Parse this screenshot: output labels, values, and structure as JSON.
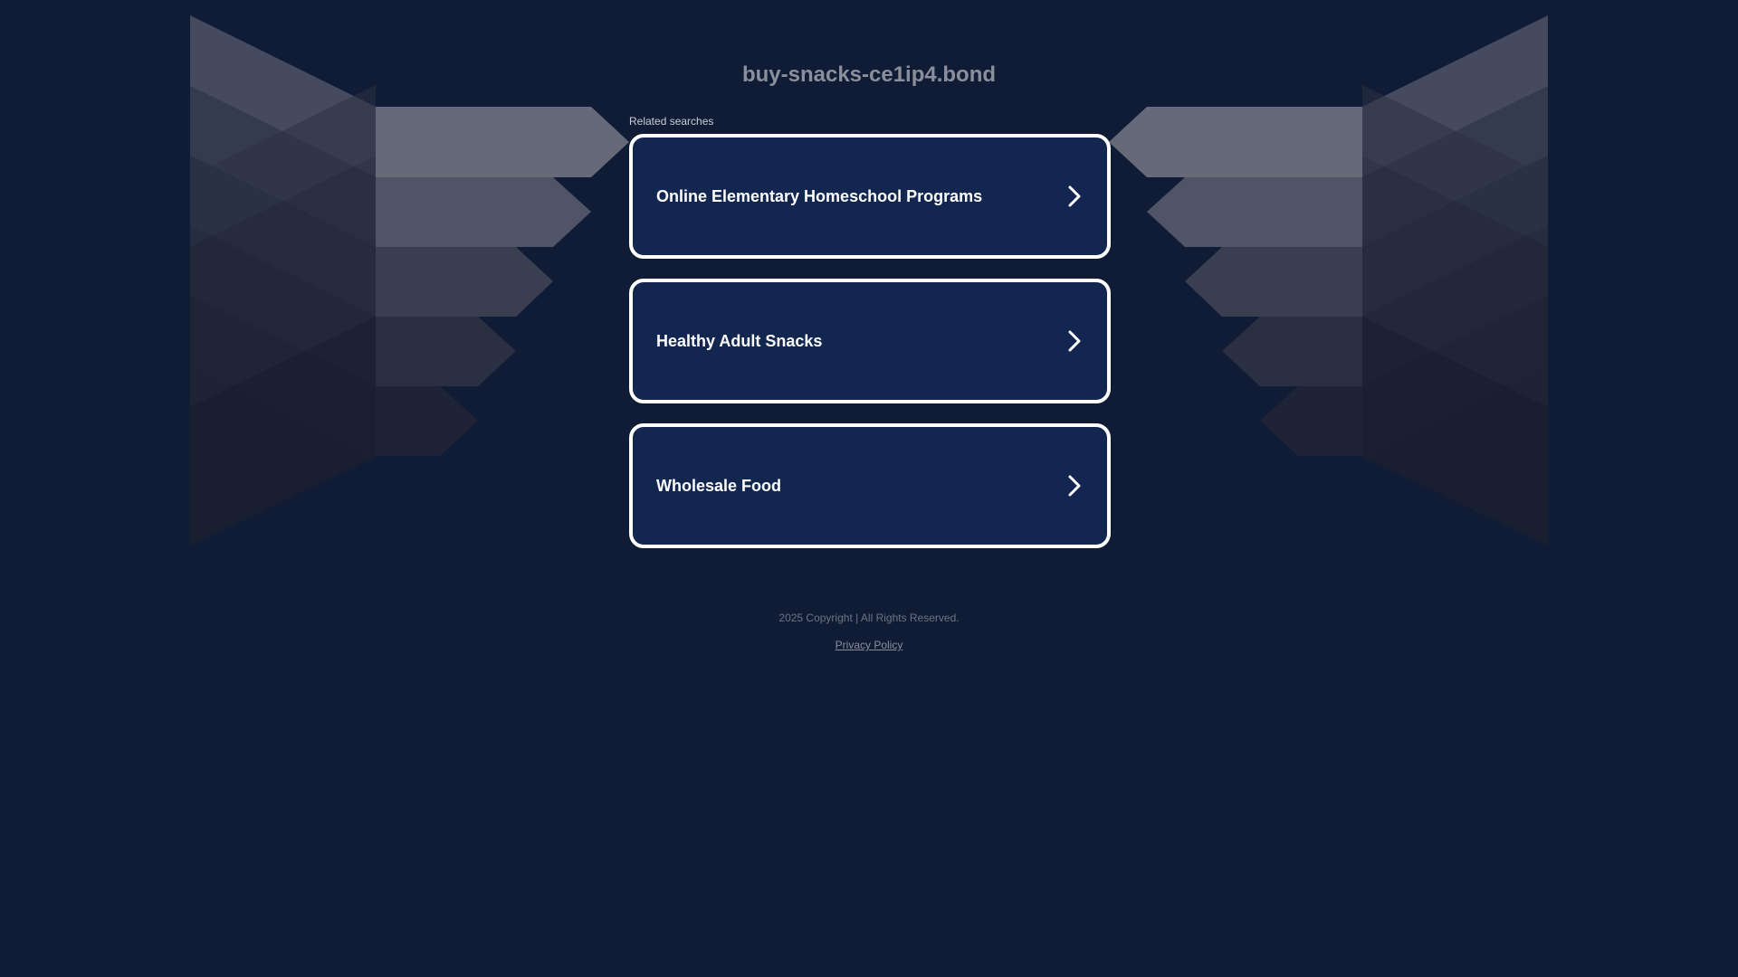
{
  "header": {
    "domain": "buy-snacks-ce1ip4.bond"
  },
  "related": {
    "heading": "Related searches",
    "links": [
      {
        "label": "Online Elementary Homeschool Programs",
        "icon": "chevron-right-icon"
      },
      {
        "label": "Healthy Adult Snacks",
        "icon": "chevron-right-icon"
      },
      {
        "label": "Wholesale Food",
        "icon": "chevron-right-icon"
      }
    ]
  },
  "footer": {
    "copyright": "2025 Copyright | All Rights Reserved.",
    "privacy_label": "Privacy Policy"
  },
  "colors": {
    "background": "#101c36",
    "card_background": "#12264f",
    "card_border": "#ffffff",
    "title_text": "#8a8f9b"
  }
}
